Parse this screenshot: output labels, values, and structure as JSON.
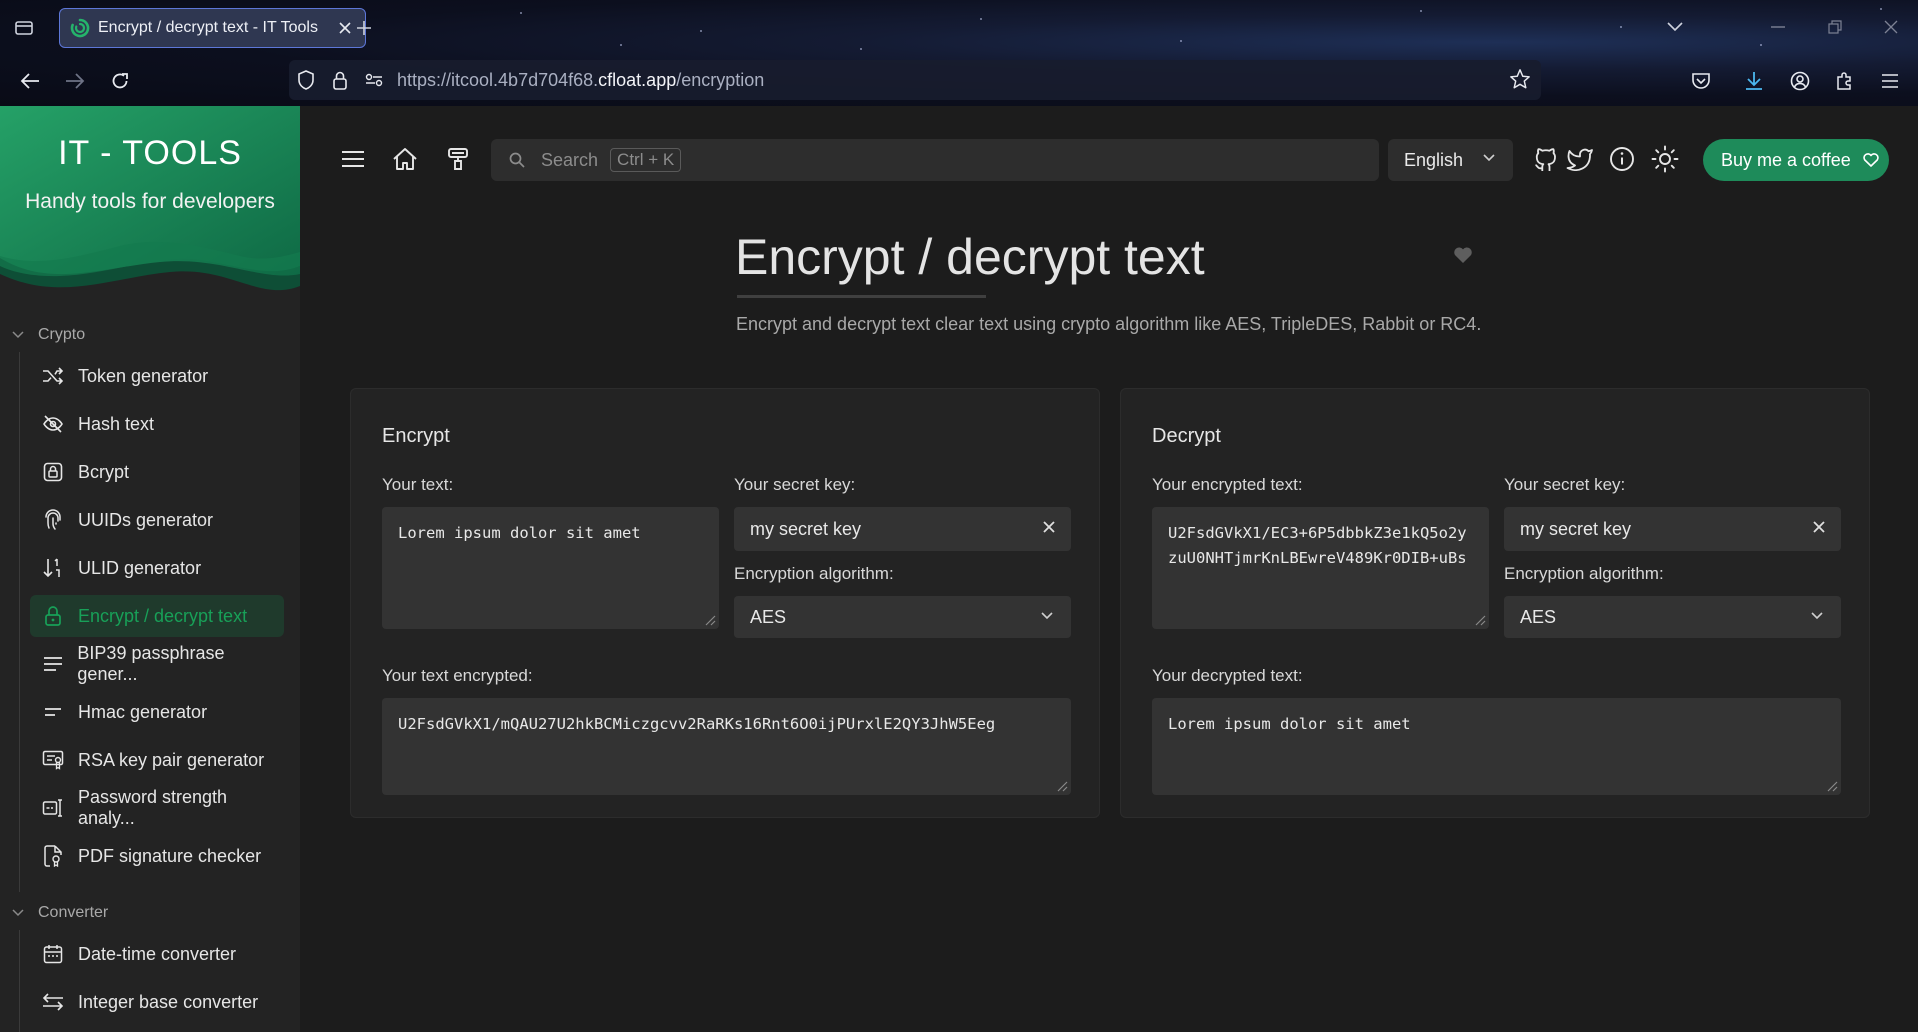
{
  "browser": {
    "tab_title": "Encrypt / decrypt text - IT Tools",
    "url_prefix": "https://itcool.4b7d704f68.",
    "url_host": "cfloat.app",
    "url_path": "/encryption"
  },
  "sidebar": {
    "logo": "IT - TOOLS",
    "tagline": "Handy tools for developers",
    "categories": [
      {
        "label": "Crypto",
        "items": [
          {
            "label": "Token generator",
            "icon": "shuffle-icon"
          },
          {
            "label": "Hash text",
            "icon": "eye-off-icon"
          },
          {
            "label": "Bcrypt",
            "icon": "lock-square-icon"
          },
          {
            "label": "UUIDs generator",
            "icon": "fingerprint-icon"
          },
          {
            "label": "ULID generator",
            "icon": "sort-numeric-icon"
          },
          {
            "label": "Encrypt / decrypt text",
            "icon": "lock-icon",
            "active": true
          },
          {
            "label": "BIP39 passphrase gener...",
            "icon": "lines-icon"
          },
          {
            "label": "Hmac generator",
            "icon": "short-lines-icon"
          },
          {
            "label": "RSA key pair generator",
            "icon": "certificate-icon"
          },
          {
            "label": "Password strength analy...",
            "icon": "password-icon"
          },
          {
            "label": "PDF signature checker",
            "icon": "file-certificate-icon"
          }
        ]
      },
      {
        "label": "Converter",
        "items": [
          {
            "label": "Date-time converter",
            "icon": "calendar-icon"
          },
          {
            "label": "Integer base converter",
            "icon": "arrows-exchange-icon"
          }
        ]
      }
    ]
  },
  "topbar": {
    "search_placeholder": "Search",
    "search_shortcut": "Ctrl + K",
    "language": "English",
    "coffee_label": "Buy me a coffee"
  },
  "page": {
    "title": "Encrypt / decrypt text",
    "description": "Encrypt and decrypt text clear text using crypto algorithm like AES, TripleDES, Rabbit or RC4."
  },
  "encrypt": {
    "title": "Encrypt",
    "text_label": "Your text:",
    "text_value": "Lorem ipsum dolor sit amet",
    "key_label": "Your secret key:",
    "key_value": "my secret key",
    "algo_label": "Encryption algorithm:",
    "algo_value": "AES",
    "output_label": "Your text encrypted:",
    "output_value": "U2FsdGVkX1/mQAU27U2hkBCMiczgcvv2RaRKs16Rnt6O0ijPUrxlE2QY3JhW5Eeg"
  },
  "decrypt": {
    "title": "Decrypt",
    "text_label": "Your encrypted text:",
    "text_value": "U2FsdGVkX1/EC3+6P5dbbkZ3e1kQ5o2yzuU0NHTjmrKnLBEwreV489Kr0DIB+uBs",
    "key_label": "Your secret key:",
    "key_value": "my secret key",
    "algo_label": "Encryption algorithm:",
    "algo_value": "AES",
    "output_label": "Your decrypted text:",
    "output_value": "Lorem ipsum dolor sit amet"
  },
  "colors": {
    "accent": "#18a058",
    "button": "#1e8b5a",
    "background": "#1c1c1c",
    "card": "#232323",
    "field": "#333333"
  }
}
